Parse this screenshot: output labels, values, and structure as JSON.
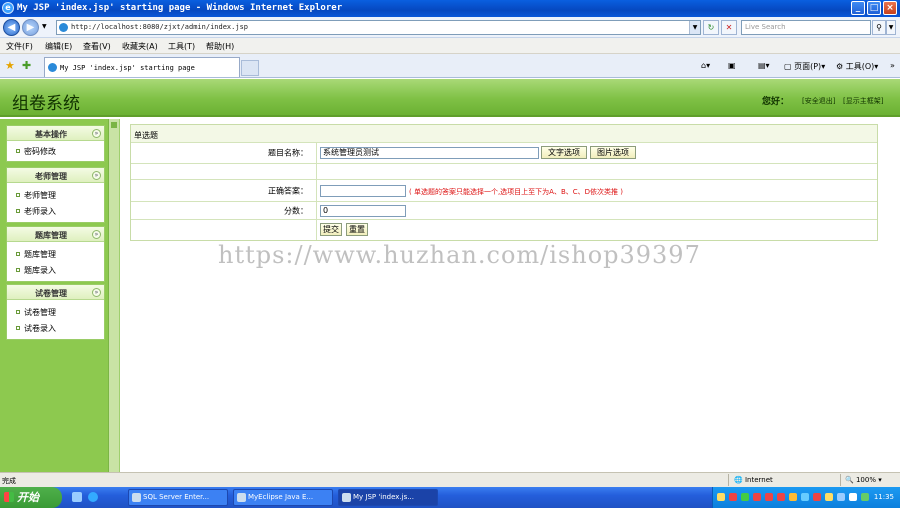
{
  "window": {
    "title": "My JSP 'index.jsp' starting page - Windows Internet Explorer",
    "minimize": "_",
    "maximize": "□",
    "close": "×"
  },
  "browser": {
    "address": "http://localhost:8080/zjxt/admin/index.jsp",
    "search_placeholder": "Live Search",
    "menu": [
      "文件(F)",
      "编辑(E)",
      "查看(V)",
      "收藏夹(A)",
      "工具(T)",
      "帮助(H)"
    ],
    "tab_title": "My JSP 'index.jsp' starting page",
    "cmd_page": "页面(P)",
    "cmd_tools": "工具(O)"
  },
  "app": {
    "title": "组卷系统",
    "greeting": "您好：",
    "link_logout": "[安全退出]",
    "link_home": "[显示主框架]"
  },
  "sidebar": {
    "panels": [
      {
        "title": "基本操作",
        "items": [
          "密码修改"
        ]
      },
      {
        "title": "老师管理",
        "items": [
          "老师管理",
          "老师录入"
        ]
      },
      {
        "title": "题库管理",
        "items": [
          "题库管理",
          "题库录入"
        ]
      },
      {
        "title": "试卷管理",
        "items": [
          "试卷管理",
          "试卷录入"
        ]
      }
    ]
  },
  "form": {
    "title": "单选题",
    "label_name": "题目名称：",
    "value_name": "系统管理员测试",
    "btn_text_option": "文字选项",
    "btn_image_option": "图片选项",
    "label_answer": "正确答案：",
    "value_answer": "",
    "answer_hint": "( 单选题的答案只能选择一个,选项目上至下为A、B、C、D依次类推 )",
    "label_score": "分数：",
    "value_score": "0",
    "btn_submit": "提交",
    "btn_reset": "重置"
  },
  "watermark": "https://www.huzhan.com/ishop39397",
  "status": {
    "text": "完成",
    "zone": "Internet",
    "zoom": "100%"
  },
  "taskbar": {
    "start": "开始",
    "tasks": [
      "SQL Server Enter...",
      "MyEclipse Java E...",
      "My JSP 'index.js..."
    ],
    "clock": "11:35"
  }
}
